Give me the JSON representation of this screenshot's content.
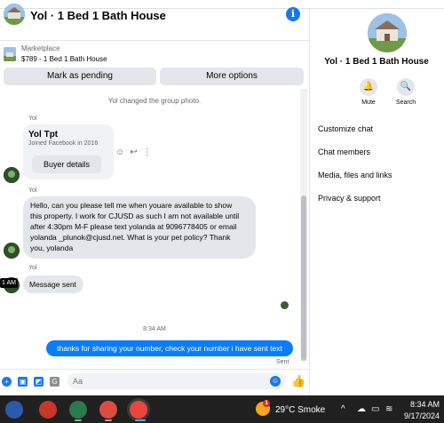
{
  "header": {
    "title": "Yol · 1 Bed 1 Bath House",
    "info_icon": "info-icon"
  },
  "marketplace": {
    "label": "Marketplace",
    "item": "$789 - 1 Bed 1 Bath House",
    "mark_pending_label": "Mark as pending",
    "more_options_label": "More options"
  },
  "conversation": {
    "system_message": "Yol changed the group photo.",
    "card": {
      "sender": "Yol",
      "name": "Yol Tpt",
      "joined": "Joined Facebook in 2016",
      "button_label": "Buyer details"
    },
    "message_long": {
      "sender": "Yol",
      "text": "Hello, can you please tell me when youare available to show\nthis property. I work for CJUSD as such I am not available until\nafter 4:30pm M-F please text yolanda at 9096778405 or email\nyolanda _plunok@cjusd.net. What is your pet policy?   Thank\nyou, yolanda"
    },
    "message_sent_text": {
      "sender": "Yol",
      "text": "Message sent",
      "hover_time": "1 AM"
    },
    "time_divider": "8:34 AM",
    "my_message": "thanks for sharing your number, check your number i have sent text",
    "status": "Sent"
  },
  "composer": {
    "placeholder": "Aa"
  },
  "right_panel": {
    "title": "Yol · 1 Bed 1 Bath House",
    "mute_label": "Mute",
    "search_label": "Search",
    "items": [
      "Customize chat",
      "Chat members",
      "Media, files and links",
      "Privacy & support"
    ]
  },
  "taskbar": {
    "weather_badge": "1",
    "weather": "29°C  Smoke",
    "time": "8:34 AM",
    "date": "9/17/2024"
  },
  "colors": {
    "accent": "#1877f2",
    "my_bubble": "#0a7cff",
    "other_bubble": "#e4e6eb",
    "taskbar": "#202020"
  }
}
